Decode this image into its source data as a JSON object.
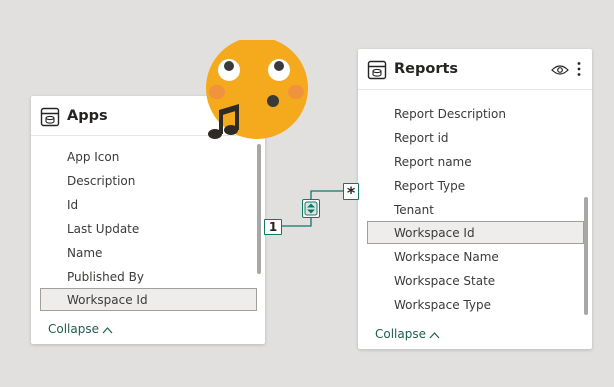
{
  "apps_table": {
    "title": "Apps",
    "fields": [
      "App Icon",
      "Description",
      "Id",
      "Last Update",
      "Name",
      "Published By",
      "Workspace Id"
    ],
    "selected_field": "Workspace Id",
    "collapse_label": "Collapse"
  },
  "reports_table": {
    "title": "Reports",
    "fields": [
      "Report Description",
      "Report id",
      "Report name",
      "Report Type",
      "Tenant",
      "Workspace Id",
      "Workspace Name",
      "Workspace State",
      "Workspace Type"
    ],
    "selected_field": "Workspace Id",
    "collapse_label": "Collapse"
  },
  "relationship": {
    "one_side_label": "1",
    "many_side_label": "*",
    "cross_filter_icon": "bidirectional-arrows-icon"
  },
  "icons": {
    "table": "table-icon",
    "visibility": "eye-icon",
    "more": "more-options-icon",
    "collapse": "chevron-up-icon",
    "overlay": "whistling-face-emoji"
  },
  "colors": {
    "background": "#e1e0de",
    "relationship_line": "#117865",
    "link_text": "#1f5f4e",
    "selected_row": "#eeedec",
    "emoji_face": "#f4aa1c"
  }
}
